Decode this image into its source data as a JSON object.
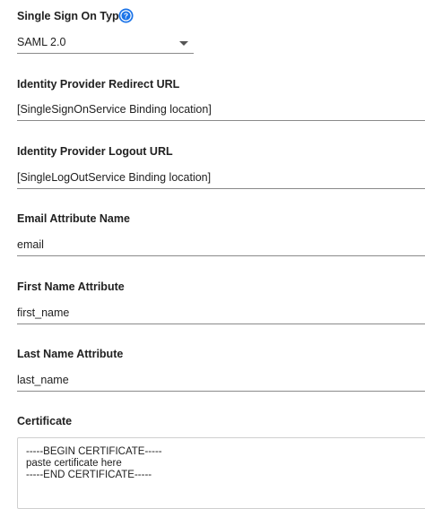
{
  "sso_type": {
    "label": "Single Sign On Type",
    "value": "SAML 2.0",
    "help_icon": "help-circle-icon",
    "accent": "#1a73e8"
  },
  "idp_redirect": {
    "label": "Identity Provider Redirect URL",
    "value": "[SingleSignOnService Binding location]"
  },
  "idp_logout": {
    "label": "Identity Provider Logout URL",
    "value": "[SingleLogOutService Binding location]"
  },
  "email_attr": {
    "label": "Email Attribute Name",
    "value": "email"
  },
  "first_name_attr": {
    "label": "First Name Attribute",
    "value": "first_name"
  },
  "last_name_attr": {
    "label": "Last Name Attribute",
    "value": "last_name"
  },
  "certificate": {
    "label": "Certificate",
    "lines": [
      "-----BEGIN CERTIFICATE-----",
      "paste certificate here",
      "-----END CERTIFICATE-----"
    ]
  }
}
